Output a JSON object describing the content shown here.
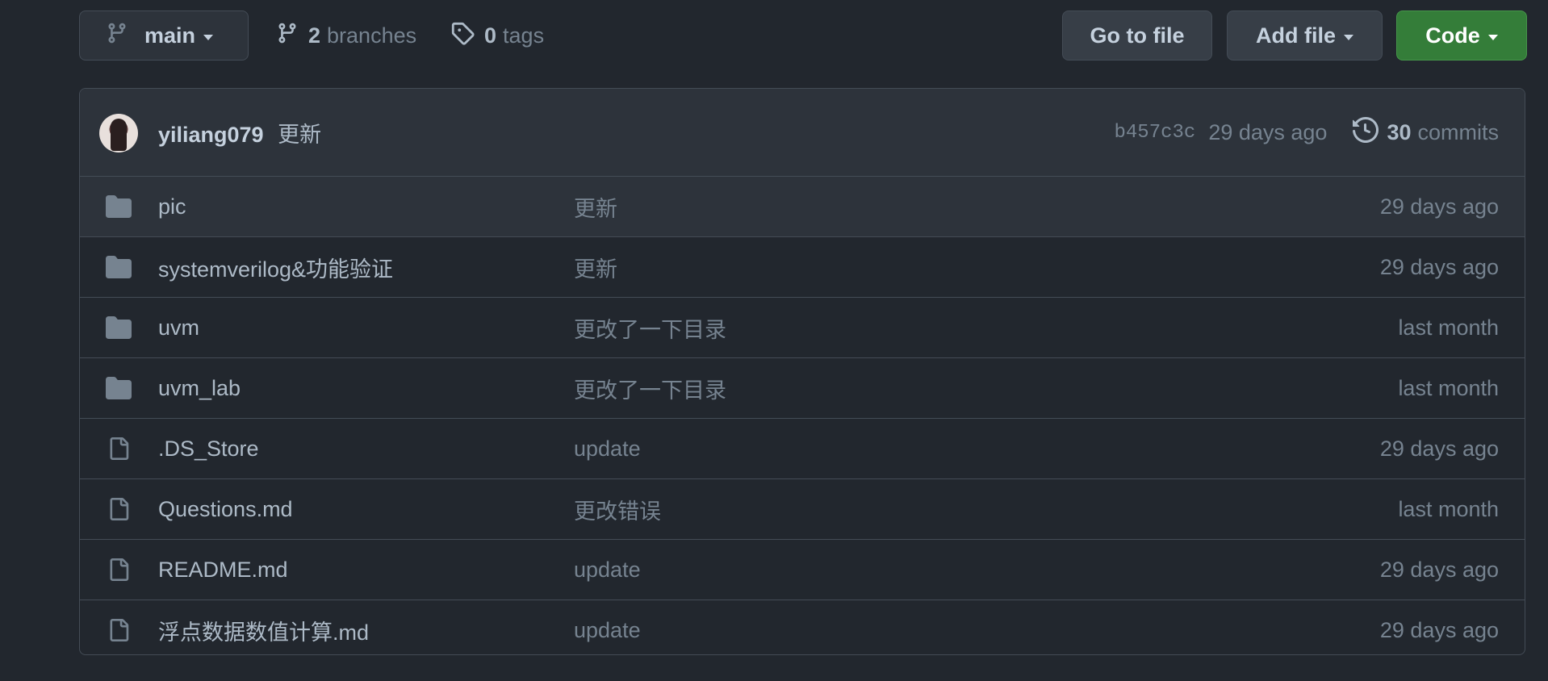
{
  "toolbar": {
    "branch_name": "main",
    "branches_count": "2",
    "branches_label": "branches",
    "tags_count": "0",
    "tags_label": "tags",
    "goto_file_label": "Go to file",
    "add_file_label": "Add file",
    "code_label": "Code"
  },
  "colors": {
    "background": "#22272e",
    "code_button": "#347d39",
    "border": "#444c56"
  },
  "commit": {
    "author": "yiliang079",
    "message": "更新",
    "sha": "b457c3c",
    "age": "29 days ago",
    "commits_count": "30",
    "commits_label": "commits"
  },
  "files": [
    {
      "type": "folder-icon",
      "name": "pic",
      "message": "更新",
      "age": "29 days ago"
    },
    {
      "type": "folder-icon",
      "name": "systemverilog&功能验证",
      "message": "更新",
      "age": "29 days ago"
    },
    {
      "type": "folder-icon",
      "name": "uvm",
      "message": "更改了一下目录",
      "age": "last month"
    },
    {
      "type": "folder-icon",
      "name": "uvm_lab",
      "message": "更改了一下目录",
      "age": "last month"
    },
    {
      "type": "file-icon",
      "name": ".DS_Store",
      "message": "update",
      "age": "29 days ago"
    },
    {
      "type": "file-icon",
      "name": "Questions.md",
      "message": "更改错误",
      "age": "last month"
    },
    {
      "type": "file-icon",
      "name": "README.md",
      "message": "update",
      "age": "29 days ago"
    },
    {
      "type": "file-icon",
      "name": "浮点数据数值计算.md",
      "message": "update",
      "age": "29 days ago"
    }
  ]
}
